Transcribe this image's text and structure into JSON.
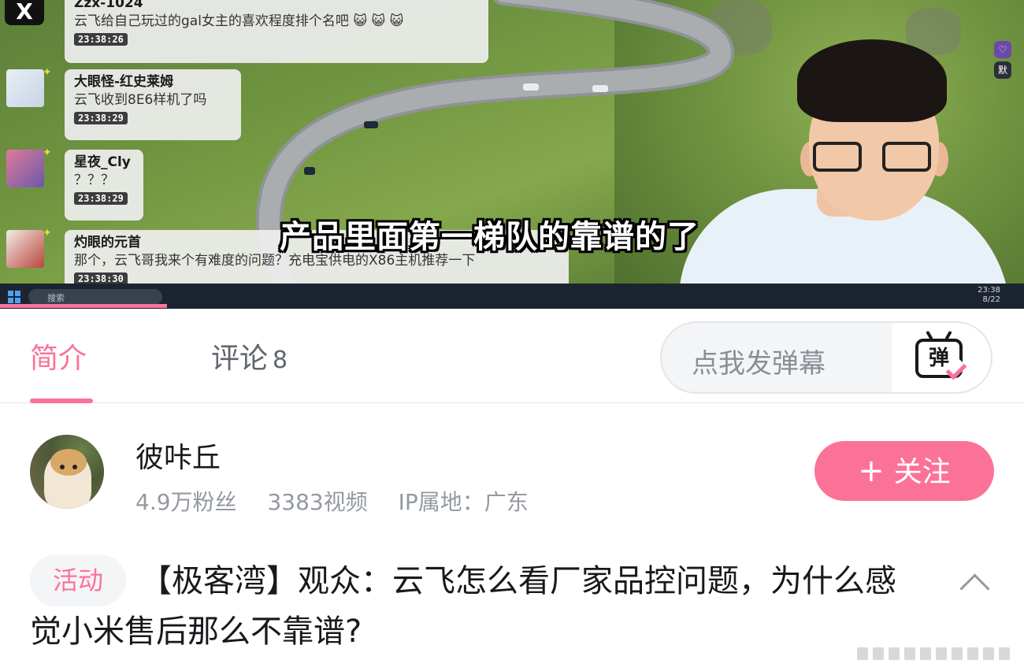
{
  "video": {
    "subtitle": "产品里面第一梯队的靠谱的了",
    "chat_logo": "X",
    "taskbar_search": "搜索",
    "taskbar_clock_time": "23:38",
    "taskbar_clock_date": "8/22",
    "side_icon_1": "♡",
    "side_icon_2": "默",
    "chat": [
      {
        "user": "Zzx-1024",
        "text": "云飞给自己玩过的gal女主的喜欢程度排个名吧 😺 😺 😺",
        "time": "23:38:26"
      },
      {
        "user": "大眼怪-红史莱姆",
        "text": "云飞收到8E6样机了吗",
        "time": "23:38:29"
      },
      {
        "user": "星夜_Cly",
        "text": "？？？",
        "time": "23:38:29"
      },
      {
        "user": "灼眼的元首",
        "text": "那个，云飞哥我来个有难度的问题？充电宝供电的X86主机推荐一下",
        "time": "23:38:30"
      }
    ]
  },
  "tabs": {
    "intro_label": "简介",
    "comments_label": "评论",
    "comments_count": "8",
    "danmaku_placeholder": "点我发弹幕",
    "danmaku_icon_text": "弹"
  },
  "uploader": {
    "name": "彼咔丘",
    "fans": "4.9万粉丝",
    "videos": "3383视频",
    "ip": "IP属地：广东",
    "follow_plus": "+",
    "follow_label": "关注"
  },
  "title": {
    "tag": "活动",
    "text": "【极客湾】观众：云飞怎么看厂家品控问题，为什么感觉小米售后那么不靠谱?"
  },
  "colors": {
    "accent": "#fb7299",
    "text_primary": "#18191c",
    "text_secondary": "#9499a0"
  }
}
